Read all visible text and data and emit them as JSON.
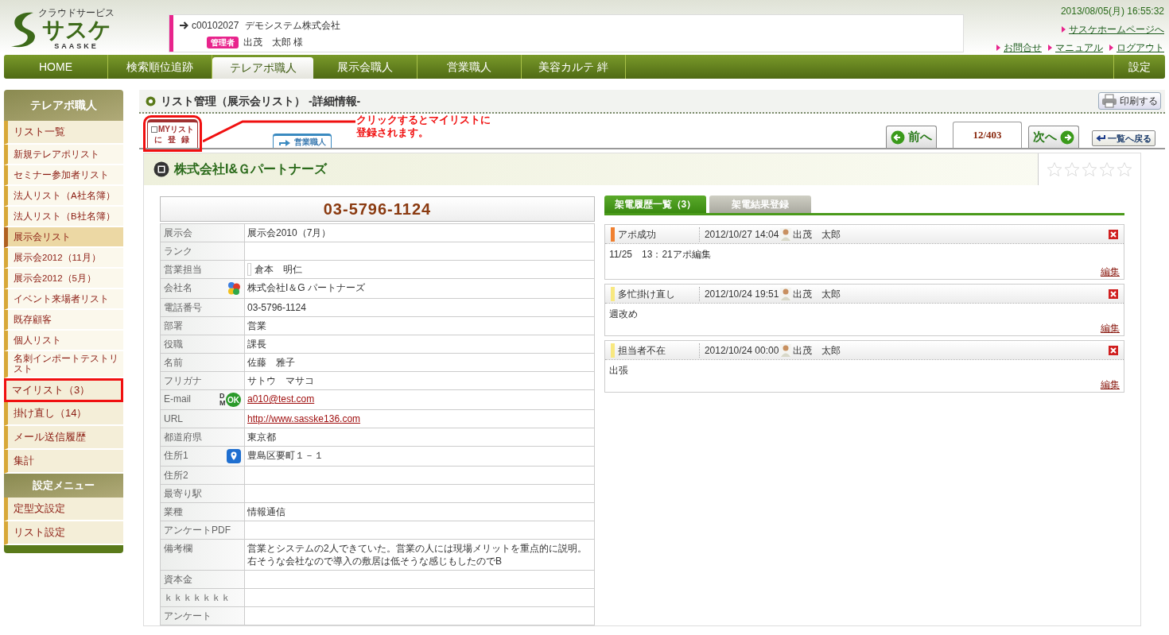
{
  "logo": {
    "tagline": "クラウドサービス",
    "name": "サスケ",
    "sub": "SAASKE"
  },
  "account": {
    "code": "c00102027",
    "company": "デモシステム株式会社",
    "role": "管理者",
    "user": "出茂　太郎 様"
  },
  "datetime": "2013/08/05(月) 16:55:32",
  "top_links": [
    [
      "サスケホームページへ"
    ],
    [
      "お問合せ",
      "マニュアル",
      "ログアウト"
    ]
  ],
  "nav": {
    "items": [
      {
        "label": "HOME",
        "selected": false
      },
      {
        "label": "検索順位追跡",
        "selected": false
      },
      {
        "label": "テレアポ職人",
        "selected": true
      },
      {
        "label": "展示会職人",
        "selected": false
      },
      {
        "label": "営業職人",
        "selected": false
      },
      {
        "label": "美容カルテ 絆",
        "selected": false
      }
    ],
    "settings": "設定"
  },
  "sidebar": {
    "sections": [
      {
        "title": "テレアポ職人",
        "items": [
          {
            "label": "リスト一覧",
            "kind": "main",
            "selected": false,
            "highlighted": false
          },
          {
            "label": "新規テレアポリスト",
            "kind": "sub",
            "selected": false,
            "highlighted": false
          },
          {
            "label": "セミナー参加者リスト",
            "kind": "sub",
            "selected": false,
            "highlighted": false
          },
          {
            "label": "法人リスト（A社名簿）",
            "kind": "sub",
            "selected": false,
            "highlighted": false
          },
          {
            "label": "法人リスト（B社名簿）",
            "kind": "sub",
            "selected": false,
            "highlighted": false
          },
          {
            "label": "展示会リスト",
            "kind": "sub",
            "selected": true,
            "highlighted": false
          },
          {
            "label": "展示会2012（11月）",
            "kind": "sub",
            "selected": false,
            "highlighted": false
          },
          {
            "label": "展示会2012（5月）",
            "kind": "sub",
            "selected": false,
            "highlighted": false
          },
          {
            "label": "イベント来場者リスト",
            "kind": "sub",
            "selected": false,
            "highlighted": false
          },
          {
            "label": "既存顧客",
            "kind": "sub",
            "selected": false,
            "highlighted": false
          },
          {
            "label": "個人リスト",
            "kind": "sub",
            "selected": false,
            "highlighted": false
          },
          {
            "label": "名刺インポートテストリスト",
            "kind": "sub",
            "selected": false,
            "highlighted": false
          },
          {
            "label": "マイリスト（3）",
            "kind": "main",
            "selected": false,
            "highlighted": true
          },
          {
            "label": "掛け直し（14）",
            "kind": "main",
            "selected": false,
            "highlighted": false
          },
          {
            "label": "メール送信履歴",
            "kind": "main",
            "selected": false,
            "highlighted": false
          },
          {
            "label": "集計",
            "kind": "main",
            "selected": false,
            "highlighted": false
          }
        ]
      },
      {
        "title": "設定メニュー",
        "items": [
          {
            "label": "定型文設定",
            "kind": "main",
            "selected": false,
            "highlighted": false
          },
          {
            "label": "リスト設定",
            "kind": "main",
            "selected": false,
            "highlighted": false
          }
        ]
      }
    ]
  },
  "page_title": "リスト管理（展示会リスト） -詳細情報-",
  "print_button": "印刷する",
  "mylist_tab": {
    "label": "MYリスト",
    "label2": "に 登 録",
    "checked": false,
    "highlighted": true
  },
  "annotation": {
    "lines": [
      "クリックするとマイリストに",
      "登録されます。"
    ]
  },
  "category_tab": "営業職人",
  "pager": {
    "prev": "前へ",
    "position": "12/403",
    "next": "次へ",
    "back": "一覧へ戻る"
  },
  "company": {
    "name": "株式会社I&Ｇパートナーズ",
    "stars": 0
  },
  "phone": "03-5796-1124",
  "details": [
    {
      "label": "展示会",
      "value": "展示会2010（7月）"
    },
    {
      "label": "ランク"
    },
    {
      "label": "営業担当",
      "value": "倉本　明仁",
      "kind": "person"
    },
    {
      "label": "会社名",
      "value": "株式会社I＆G パートナーズ",
      "kind": "company"
    },
    {
      "label": "電話番号",
      "value": "03-5796-1124"
    },
    {
      "label": "部署",
      "value": "営業"
    },
    {
      "label": "役職",
      "value": "課長"
    },
    {
      "label": "名前",
      "value": "佐藤　雅子"
    },
    {
      "label": "フリガナ",
      "value": "サトウ　マサコ"
    },
    {
      "label": "E-mail",
      "value": "a010@test.com",
      "kind": "email",
      "badge": {
        "small": "DM",
        "label": "OK"
      }
    },
    {
      "label": "URL",
      "value": "http://www.sasske136.com",
      "kind": "link"
    },
    {
      "label": "都道府県",
      "value": "東京都"
    },
    {
      "label": "住所1",
      "value": "豊島区要町１－１",
      "kind": "address"
    },
    {
      "label": "住所2"
    },
    {
      "label": "最寄り駅"
    },
    {
      "label": "業種",
      "value": "情報通信"
    },
    {
      "label": "アンケートPDF"
    },
    {
      "label": "備考欄",
      "value": "営業とシステムの2人できていた。営業の人には現場メリットを重点的に説明。右そうな会社なので導入の敷居は低そうな感じもしたのでB"
    },
    {
      "label": "資本金"
    },
    {
      "label": "ｋｋｋｋｋｋｋ"
    },
    {
      "label": "アンケート"
    }
  ],
  "history_tabs": [
    {
      "label": "架電履歴一覧（3）",
      "selected": true
    },
    {
      "label": "架電結果登録",
      "selected": false
    }
  ],
  "history": [
    {
      "status": "アポ成功",
      "color": "#f08030",
      "datetime": "2012/10/27 14:04",
      "user": "出茂　太郎",
      "note": "11/25　13：21アポ編集",
      "edit": "編集"
    },
    {
      "status": "多忙掛け直し",
      "color": "#f8e880",
      "datetime": "2012/10/24 19:51",
      "user": "出茂　太郎",
      "note": "週改め",
      "edit": "編集"
    },
    {
      "status": "担当者不在",
      "color": "#f8e880",
      "datetime": "2012/10/24 00:00",
      "user": "出茂　太郎",
      "note": "出張",
      "edit": "編集"
    }
  ]
}
